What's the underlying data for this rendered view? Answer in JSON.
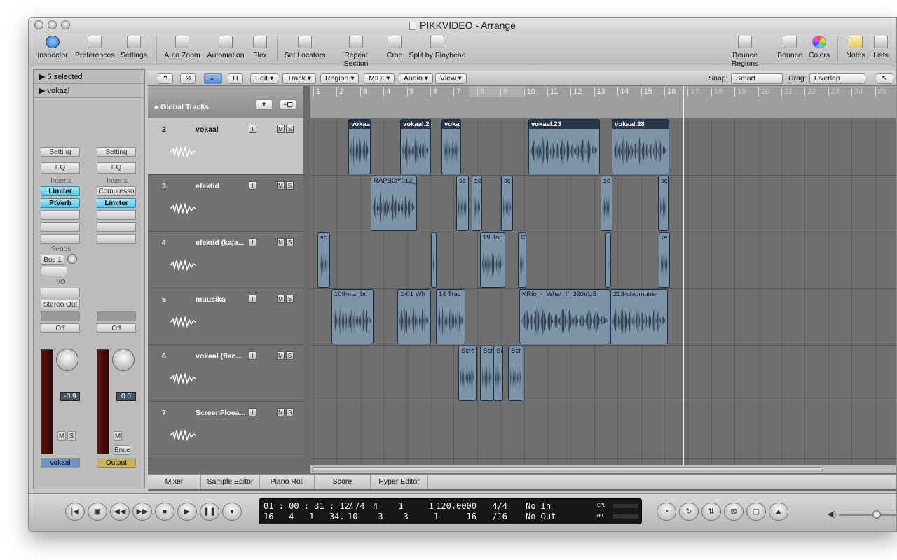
{
  "window": {
    "title": "PIKKVIDEO - Arrange"
  },
  "toolbar": {
    "inspector": "Inspector",
    "preferences": "Preferences",
    "settings": "Settings",
    "auto_zoom": "Auto Zoom",
    "automation": "Automation",
    "flex": "Flex",
    "set_locators": "Set Locators",
    "repeat_section": "Repeat Section",
    "crop": "Crop",
    "split_by_playhead": "Split by Playhead",
    "bounce_regions": "Bounce Regions",
    "bounce": "Bounce",
    "colors": "Colors",
    "notes": "Notes",
    "lists": "Lists"
  },
  "inspector": {
    "selected": "5 selected",
    "track_name": "vokaal",
    "strip1": {
      "setting": "Setting",
      "eq": "EQ",
      "inserts": "Inserts",
      "insert1": "Limiter",
      "insert2": "PtVerb",
      "sends": "Sends",
      "bus": "Bus 1",
      "io": "I/O",
      "output": "Stereo Out",
      "auto": "Off",
      "fader_value": "-0.9",
      "m": "M",
      "s": "S",
      "name": "vokaal"
    },
    "strip2": {
      "setting": "Setting",
      "eq": "EQ",
      "inserts": "Inserts",
      "insert1": "Compresso",
      "insert2": "Limiter",
      "auto": "Off",
      "fader_value": "0.0",
      "m": "M",
      "bnce": "Bnce",
      "name": "Output"
    }
  },
  "localbar": {
    "edit": "Edit",
    "track": "Track",
    "region": "Region",
    "midi": "MIDI",
    "audio": "Audio",
    "view": "View",
    "snap_label": "Snap:",
    "snap_value": "Smart",
    "drag_label": "Drag:",
    "drag_value": "Overlap",
    "h": "H"
  },
  "global_tracks": "Global Tracks",
  "ruler": [
    "1",
    "2",
    "3",
    "4",
    "5",
    "6",
    "7",
    "8",
    "9",
    "10",
    "11",
    "12",
    "13",
    "14",
    "15",
    "16",
    "17",
    "18",
    "19",
    "20",
    "21",
    "22",
    "23",
    "24",
    "25"
  ],
  "tracks": [
    {
      "num": "2",
      "name": "vokaal",
      "selected": true
    },
    {
      "num": "3",
      "name": "efektid",
      "selected": false
    },
    {
      "num": "4",
      "name": "efektid (kaja...",
      "selected": false
    },
    {
      "num": "5",
      "name": "muusika",
      "selected": false
    },
    {
      "num": "6",
      "name": "vokaal (flan...",
      "selected": false
    },
    {
      "num": "7",
      "name": "ScreenFloea...",
      "selected": false
    }
  ],
  "track_buttons": {
    "i": "I",
    "m": "M",
    "s": "S"
  },
  "regions": {
    "r1": "vokaa",
    "r2": "vokaal.2",
    "r3": "voka",
    "r4": "vokaal.23",
    "r5": "vokaal.28",
    "r6": "RAPBOY012_",
    "r7": "sc",
    "r8": "sc",
    "r9": "sc",
    "r10": "sc",
    "r11": "sc",
    "r12": "sc",
    "r13": "19 Joh",
    "r14": "C",
    "r15": "re",
    "r16": "109-mz_bri",
    "r17": "1-01 Wh",
    "r18": "14 Trac",
    "r19": "KRio_-_What_If_320v1.5",
    "r20": "213-chipmunk-",
    "r21": "Scre",
    "r22": "Scr",
    "r23": "Sc",
    "r24": "Scr"
  },
  "bottom_tabs": {
    "mixer": "Mixer",
    "sample_editor": "Sample Editor",
    "piano_roll": "Piano Roll",
    "score": "Score",
    "hyper_editor": "Hyper Editor"
  },
  "transport": {
    "smpte": "01 : 00 : 31 : 12.74",
    "smpte2": "16   4   1   34.",
    "bars": "7    4    1     1",
    "bars2": "10    3    3     1",
    "tempo": "120.0000",
    "tempo2": "16",
    "sig": "4/4",
    "sig2": "/16",
    "in": "No In",
    "out": "No Out",
    "cpu": "CPU",
    "hd": "HD"
  }
}
